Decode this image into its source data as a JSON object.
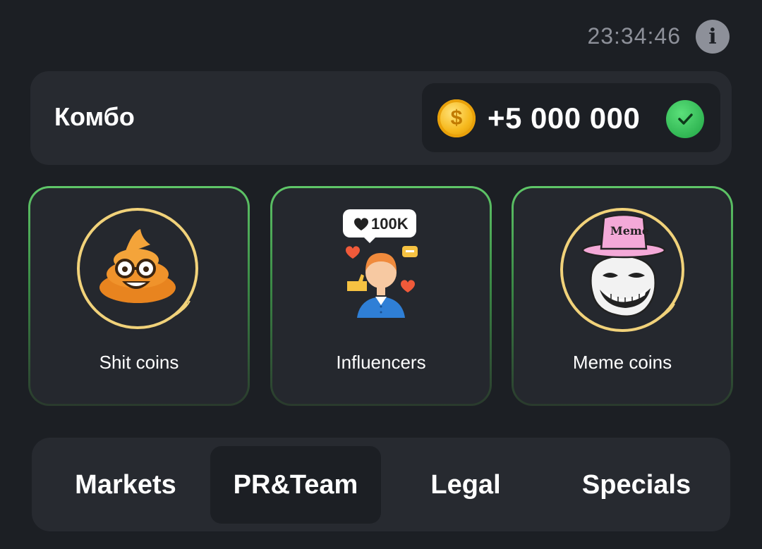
{
  "header": {
    "time": "23:34:46",
    "info_icon": "info-icon"
  },
  "combo": {
    "title": "Комбо",
    "reward": "+5 000 000",
    "coin_symbol": "$",
    "claimed": true
  },
  "cards": [
    {
      "label": "Shit coins",
      "icon": "poop-emoji-icon"
    },
    {
      "label": "Influencers",
      "icon": "influencer-icon",
      "badge": "100K"
    },
    {
      "label": "Meme coins",
      "icon": "troll-face-icon",
      "hat_text": "Meme"
    }
  ],
  "tabs": [
    {
      "label": "Markets",
      "active": false
    },
    {
      "label": "PR&Team",
      "active": true
    },
    {
      "label": "Legal",
      "active": false
    },
    {
      "label": "Specials",
      "active": false
    }
  ],
  "colors": {
    "background": "#1c1f24",
    "panel": "#272a30",
    "card_border": "#5fc768",
    "coin": "#f6b81c",
    "check": "#1fa443",
    "muted_text": "#8d9099"
  }
}
